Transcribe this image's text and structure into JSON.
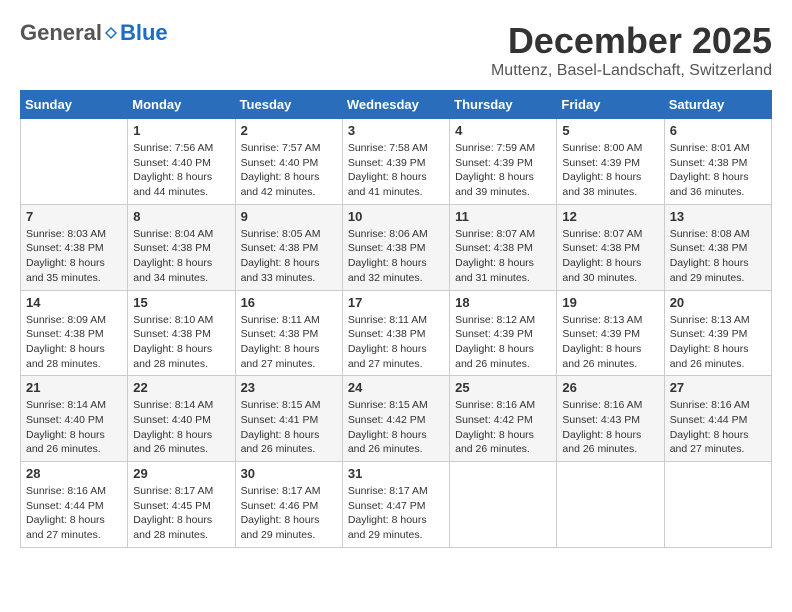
{
  "header": {
    "logo_general": "General",
    "logo_blue": "Blue",
    "month_title": "December 2025",
    "location": "Muttenz, Basel-Landschaft, Switzerland"
  },
  "weekdays": [
    "Sunday",
    "Monday",
    "Tuesday",
    "Wednesday",
    "Thursday",
    "Friday",
    "Saturday"
  ],
  "weeks": [
    [
      {
        "day": "",
        "sunrise": "",
        "sunset": "",
        "daylight": ""
      },
      {
        "day": "1",
        "sunrise": "Sunrise: 7:56 AM",
        "sunset": "Sunset: 4:40 PM",
        "daylight": "Daylight: 8 hours and 44 minutes."
      },
      {
        "day": "2",
        "sunrise": "Sunrise: 7:57 AM",
        "sunset": "Sunset: 4:40 PM",
        "daylight": "Daylight: 8 hours and 42 minutes."
      },
      {
        "day": "3",
        "sunrise": "Sunrise: 7:58 AM",
        "sunset": "Sunset: 4:39 PM",
        "daylight": "Daylight: 8 hours and 41 minutes."
      },
      {
        "day": "4",
        "sunrise": "Sunrise: 7:59 AM",
        "sunset": "Sunset: 4:39 PM",
        "daylight": "Daylight: 8 hours and 39 minutes."
      },
      {
        "day": "5",
        "sunrise": "Sunrise: 8:00 AM",
        "sunset": "Sunset: 4:39 PM",
        "daylight": "Daylight: 8 hours and 38 minutes."
      },
      {
        "day": "6",
        "sunrise": "Sunrise: 8:01 AM",
        "sunset": "Sunset: 4:38 PM",
        "daylight": "Daylight: 8 hours and 36 minutes."
      }
    ],
    [
      {
        "day": "7",
        "sunrise": "Sunrise: 8:03 AM",
        "sunset": "Sunset: 4:38 PM",
        "daylight": "Daylight: 8 hours and 35 minutes."
      },
      {
        "day": "8",
        "sunrise": "Sunrise: 8:04 AM",
        "sunset": "Sunset: 4:38 PM",
        "daylight": "Daylight: 8 hours and 34 minutes."
      },
      {
        "day": "9",
        "sunrise": "Sunrise: 8:05 AM",
        "sunset": "Sunset: 4:38 PM",
        "daylight": "Daylight: 8 hours and 33 minutes."
      },
      {
        "day": "10",
        "sunrise": "Sunrise: 8:06 AM",
        "sunset": "Sunset: 4:38 PM",
        "daylight": "Daylight: 8 hours and 32 minutes."
      },
      {
        "day": "11",
        "sunrise": "Sunrise: 8:07 AM",
        "sunset": "Sunset: 4:38 PM",
        "daylight": "Daylight: 8 hours and 31 minutes."
      },
      {
        "day": "12",
        "sunrise": "Sunrise: 8:07 AM",
        "sunset": "Sunset: 4:38 PM",
        "daylight": "Daylight: 8 hours and 30 minutes."
      },
      {
        "day": "13",
        "sunrise": "Sunrise: 8:08 AM",
        "sunset": "Sunset: 4:38 PM",
        "daylight": "Daylight: 8 hours and 29 minutes."
      }
    ],
    [
      {
        "day": "14",
        "sunrise": "Sunrise: 8:09 AM",
        "sunset": "Sunset: 4:38 PM",
        "daylight": "Daylight: 8 hours and 28 minutes."
      },
      {
        "day": "15",
        "sunrise": "Sunrise: 8:10 AM",
        "sunset": "Sunset: 4:38 PM",
        "daylight": "Daylight: 8 hours and 28 minutes."
      },
      {
        "day": "16",
        "sunrise": "Sunrise: 8:11 AM",
        "sunset": "Sunset: 4:38 PM",
        "daylight": "Daylight: 8 hours and 27 minutes."
      },
      {
        "day": "17",
        "sunrise": "Sunrise: 8:11 AM",
        "sunset": "Sunset: 4:38 PM",
        "daylight": "Daylight: 8 hours and 27 minutes."
      },
      {
        "day": "18",
        "sunrise": "Sunrise: 8:12 AM",
        "sunset": "Sunset: 4:39 PM",
        "daylight": "Daylight: 8 hours and 26 minutes."
      },
      {
        "day": "19",
        "sunrise": "Sunrise: 8:13 AM",
        "sunset": "Sunset: 4:39 PM",
        "daylight": "Daylight: 8 hours and 26 minutes."
      },
      {
        "day": "20",
        "sunrise": "Sunrise: 8:13 AM",
        "sunset": "Sunset: 4:39 PM",
        "daylight": "Daylight: 8 hours and 26 minutes."
      }
    ],
    [
      {
        "day": "21",
        "sunrise": "Sunrise: 8:14 AM",
        "sunset": "Sunset: 4:40 PM",
        "daylight": "Daylight: 8 hours and 26 minutes."
      },
      {
        "day": "22",
        "sunrise": "Sunrise: 8:14 AM",
        "sunset": "Sunset: 4:40 PM",
        "daylight": "Daylight: 8 hours and 26 minutes."
      },
      {
        "day": "23",
        "sunrise": "Sunrise: 8:15 AM",
        "sunset": "Sunset: 4:41 PM",
        "daylight": "Daylight: 8 hours and 26 minutes."
      },
      {
        "day": "24",
        "sunrise": "Sunrise: 8:15 AM",
        "sunset": "Sunset: 4:42 PM",
        "daylight": "Daylight: 8 hours and 26 minutes."
      },
      {
        "day": "25",
        "sunrise": "Sunrise: 8:16 AM",
        "sunset": "Sunset: 4:42 PM",
        "daylight": "Daylight: 8 hours and 26 minutes."
      },
      {
        "day": "26",
        "sunrise": "Sunrise: 8:16 AM",
        "sunset": "Sunset: 4:43 PM",
        "daylight": "Daylight: 8 hours and 26 minutes."
      },
      {
        "day": "27",
        "sunrise": "Sunrise: 8:16 AM",
        "sunset": "Sunset: 4:44 PM",
        "daylight": "Daylight: 8 hours and 27 minutes."
      }
    ],
    [
      {
        "day": "28",
        "sunrise": "Sunrise: 8:16 AM",
        "sunset": "Sunset: 4:44 PM",
        "daylight": "Daylight: 8 hours and 27 minutes."
      },
      {
        "day": "29",
        "sunrise": "Sunrise: 8:17 AM",
        "sunset": "Sunset: 4:45 PM",
        "daylight": "Daylight: 8 hours and 28 minutes."
      },
      {
        "day": "30",
        "sunrise": "Sunrise: 8:17 AM",
        "sunset": "Sunset: 4:46 PM",
        "daylight": "Daylight: 8 hours and 29 minutes."
      },
      {
        "day": "31",
        "sunrise": "Sunrise: 8:17 AM",
        "sunset": "Sunset: 4:47 PM",
        "daylight": "Daylight: 8 hours and 29 minutes."
      },
      {
        "day": "",
        "sunrise": "",
        "sunset": "",
        "daylight": ""
      },
      {
        "day": "",
        "sunrise": "",
        "sunset": "",
        "daylight": ""
      },
      {
        "day": "",
        "sunrise": "",
        "sunset": "",
        "daylight": ""
      }
    ]
  ]
}
